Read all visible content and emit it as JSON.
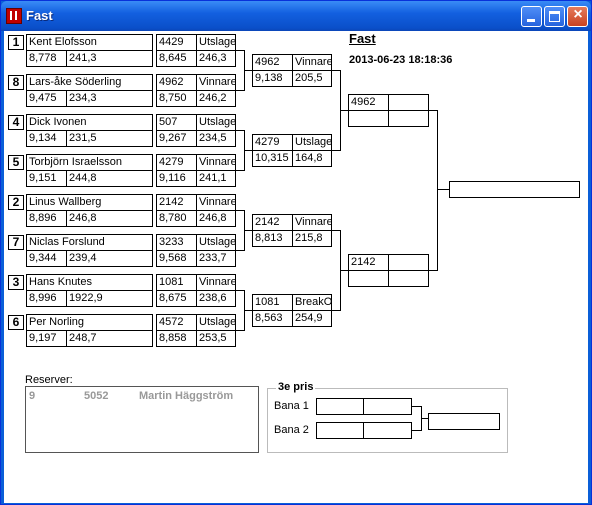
{
  "window": {
    "title": "Fast"
  },
  "header": {
    "title": "Fast",
    "datetime": "2013-06-23 18:18:36"
  },
  "seeds": [
    "1",
    "8",
    "4",
    "5",
    "2",
    "7",
    "3",
    "6"
  ],
  "round1": [
    {
      "name": "Kent Elofsson",
      "a": "8,778",
      "b": "241,3"
    },
    {
      "name": "Lars-åke Söderling",
      "a": "9,475",
      "b": "234,3"
    },
    {
      "name": "Dick Ivonen",
      "a": "9,134",
      "b": "231,5"
    },
    {
      "name": "Torbjörn Israelsson",
      "a": "9,151",
      "b": "244,8"
    },
    {
      "name": "Linus Wallberg",
      "a": "8,896",
      "b": "246,8"
    },
    {
      "name": "Niclas Forslund",
      "a": "9,344",
      "b": "239,4"
    },
    {
      "name": "Hans Knutes",
      "a": "8,996",
      "b": "1922,9"
    },
    {
      "name": "Per Norling",
      "a": "9,197",
      "b": "248,7"
    }
  ],
  "round1_results": [
    {
      "id": "4429",
      "status": "Utslagen",
      "a": "8,645",
      "b": "246,3"
    },
    {
      "id": "4962",
      "status": "Vinnare",
      "a": "8,750",
      "b": "246,2"
    },
    {
      "id": "507",
      "status": "Utslagen",
      "a": "9,267",
      "b": "234,5"
    },
    {
      "id": "4279",
      "status": "Vinnare",
      "a": "9,116",
      "b": "241,1"
    },
    {
      "id": "2142",
      "status": "Vinnare",
      "a": "8,780",
      "b": "246,8"
    },
    {
      "id": "3233",
      "status": "Utslagen",
      "a": "9,568",
      "b": "233,7"
    },
    {
      "id": "1081",
      "status": "Vinnare",
      "a": "8,675",
      "b": "238,6"
    },
    {
      "id": "4572",
      "status": "Utslagen",
      "a": "8,858",
      "b": "253,5"
    }
  ],
  "round2": [
    {
      "id": "4962",
      "status": "Vinnare",
      "a": "9,138",
      "b": "205,5"
    },
    {
      "id": "4279",
      "status": "Utslagen",
      "a": "10,315",
      "b": "164,8"
    },
    {
      "id": "2142",
      "status": "Vinnare",
      "a": "8,813",
      "b": "215,8"
    },
    {
      "id": "1081",
      "status": "BreakOut",
      "a": "8,563",
      "b": "254,9"
    }
  ],
  "semis": [
    {
      "id": "4962",
      "status": ""
    },
    {
      "id": "2142",
      "status": ""
    }
  ],
  "final": {
    "value": ""
  },
  "reserves": {
    "label": "Reserver:",
    "rows": [
      {
        "num": "9",
        "id": "5052",
        "name": "Martin Häggström"
      }
    ]
  },
  "third_place": {
    "legend": "3e pris",
    "bana1": "Bana 1",
    "bana2": "Bana 2"
  }
}
